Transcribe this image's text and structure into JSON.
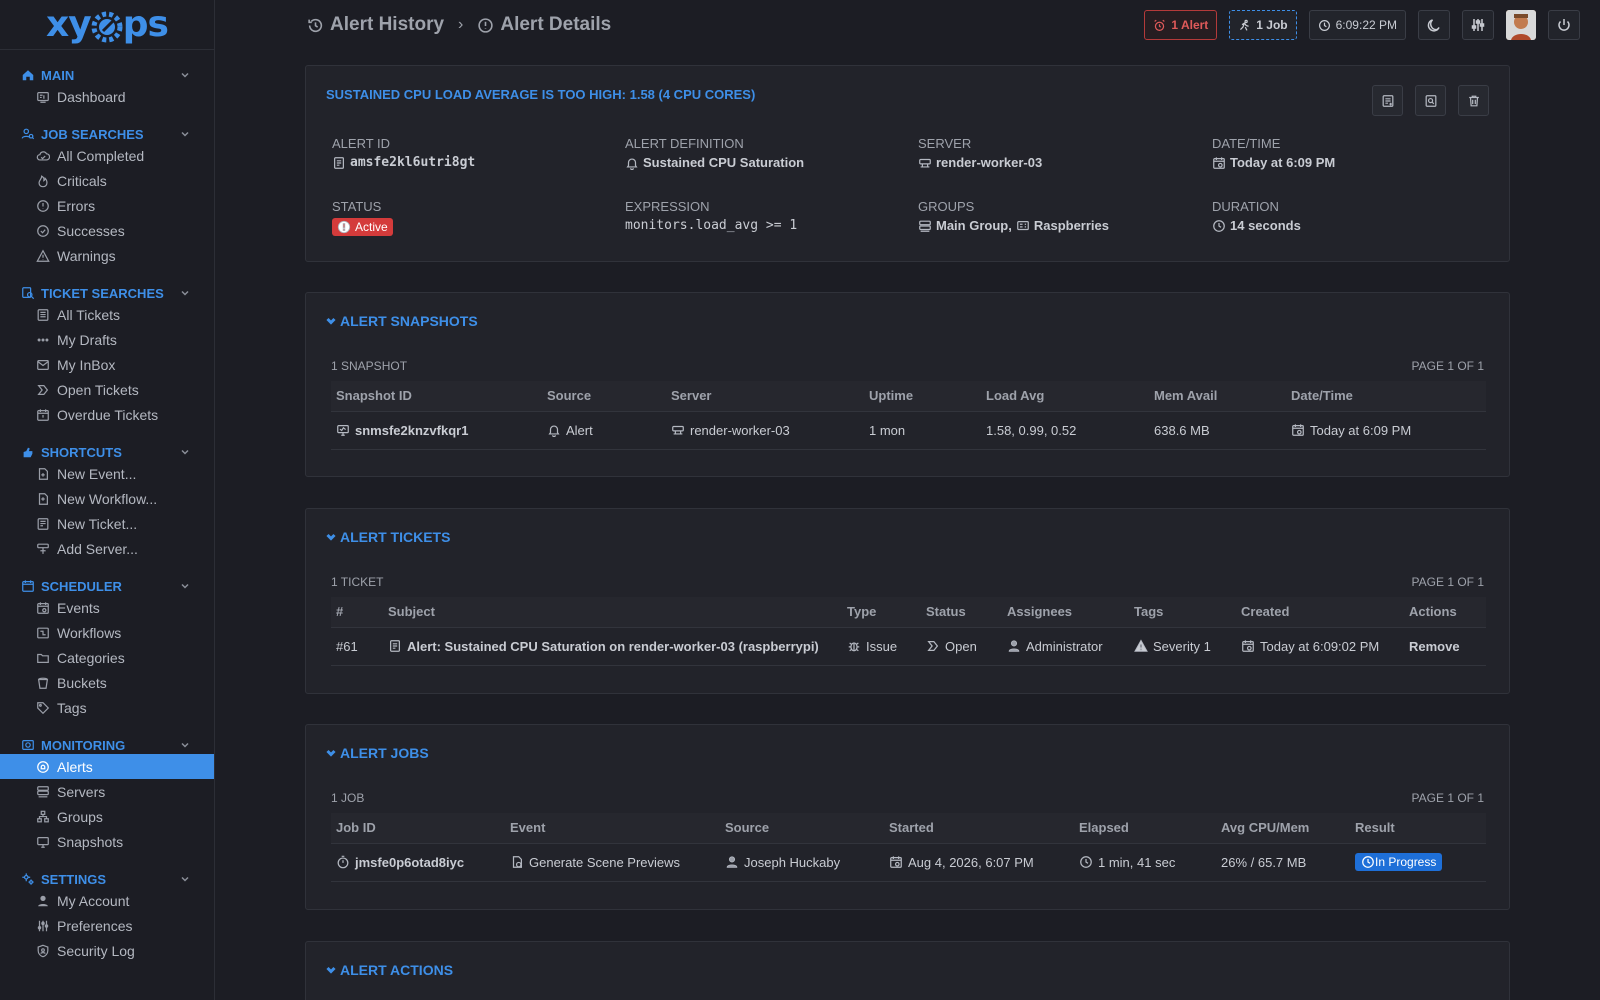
{
  "sidebar": {
    "logo": {
      "left": "xy",
      "right": "ps"
    },
    "sections": [
      {
        "title": "Main",
        "icon": "home-icon",
        "items": [
          {
            "label": "Dashboard",
            "icon": "dashboard-icon"
          }
        ]
      },
      {
        "title": "Job Searches",
        "icon": "job-search-icon",
        "items": [
          {
            "label": "All Completed",
            "icon": "cloud-check-icon"
          },
          {
            "label": "Criticals",
            "icon": "fire-icon"
          },
          {
            "label": "Errors",
            "icon": "alert-circle-icon"
          },
          {
            "label": "Successes",
            "icon": "check-circle-icon"
          },
          {
            "label": "Warnings",
            "icon": "warning-triangle-icon"
          }
        ]
      },
      {
        "title": "Ticket Searches",
        "icon": "ticket-search-icon",
        "items": [
          {
            "label": "All Tickets",
            "icon": "ticket-list-icon"
          },
          {
            "label": "My Drafts",
            "icon": "dots-icon"
          },
          {
            "label": "My InBox",
            "icon": "inbox-icon"
          },
          {
            "label": "Open Tickets",
            "icon": "open-ticket-icon"
          },
          {
            "label": "Overdue Tickets",
            "icon": "calendar-alert-icon"
          }
        ]
      },
      {
        "title": "Shortcuts",
        "icon": "shortcuts-icon",
        "items": [
          {
            "label": "New Event...",
            "icon": "new-event-icon"
          },
          {
            "label": "New Workflow...",
            "icon": "new-workflow-icon"
          },
          {
            "label": "New Ticket...",
            "icon": "new-ticket-icon"
          },
          {
            "label": "Add Server...",
            "icon": "add-server-icon"
          }
        ]
      },
      {
        "title": "Scheduler",
        "icon": "scheduler-icon",
        "items": [
          {
            "label": "Events",
            "icon": "calendar-icon"
          },
          {
            "label": "Workflows",
            "icon": "workflow-icon"
          },
          {
            "label": "Categories",
            "icon": "folder-icon"
          },
          {
            "label": "Buckets",
            "icon": "bucket-icon"
          },
          {
            "label": "Tags",
            "icon": "tag-icon"
          }
        ]
      },
      {
        "title": "Monitoring",
        "icon": "monitoring-icon",
        "items": [
          {
            "label": "Alerts",
            "icon": "alert-bell-icon",
            "active": true
          },
          {
            "label": "Servers",
            "icon": "server-icon"
          },
          {
            "label": "Groups",
            "icon": "groups-icon"
          },
          {
            "label": "Snapshots",
            "icon": "snapshot-icon"
          }
        ]
      },
      {
        "title": "Settings",
        "icon": "settings-icon",
        "items": [
          {
            "label": "My Account",
            "icon": "user-icon"
          },
          {
            "label": "Preferences",
            "icon": "preferences-icon"
          },
          {
            "label": "Security Log",
            "icon": "shield-icon"
          }
        ]
      }
    ]
  },
  "header": {
    "breadcrumb": [
      {
        "label": "Alert History"
      },
      {
        "label": "Alert Details"
      }
    ],
    "alert_count": "1 Alert",
    "job_count": "1 Job",
    "clock": "6:09:22 PM"
  },
  "alert": {
    "title": "Sustained CPU load average is too high: 1.58 (4 CPU cores)",
    "fields": {
      "alert_id": {
        "label": "Alert ID",
        "value": "amsfe2kl6utri8gt"
      },
      "definition": {
        "label": "Alert Definition",
        "value": "Sustained CPU Saturation"
      },
      "server": {
        "label": "Server",
        "value": "render-worker-03"
      },
      "datetime": {
        "label": "Date/Time",
        "value": "Today at 6:09 PM"
      },
      "status": {
        "label": "Status",
        "value": "Active"
      },
      "expression": {
        "label": "Expression",
        "value": "monitors.load_avg >= 1"
      },
      "groups": {
        "label": "Groups",
        "value1": "Main Group,",
        "value2": "Raspberries"
      },
      "duration": {
        "label": "Duration",
        "value": "14 seconds"
      }
    }
  },
  "snapshots": {
    "title": "Alert Snapshots",
    "count": "1 Snapshot",
    "page": "Page 1 of 1",
    "columns": [
      "Snapshot ID",
      "Source",
      "Server",
      "Uptime",
      "Load Avg",
      "Mem Avail",
      "Date/Time"
    ],
    "rows": [
      {
        "id": "snmsfe2knzvfkqr1",
        "source": "Alert",
        "server": "render-worker-03",
        "uptime": "1 mon",
        "load": "1.58, 0.99, 0.52",
        "mem": "638.6 MB",
        "date": "Today at 6:09 PM"
      }
    ]
  },
  "tickets": {
    "title": "Alert Tickets",
    "count": "1 Ticket",
    "page": "Page 1 of 1",
    "columns": [
      "#",
      "Subject",
      "Type",
      "Status",
      "Assignees",
      "Tags",
      "Created",
      "Actions"
    ],
    "rows": [
      {
        "num": "#61",
        "subject": "Alert: Sustained CPU Saturation on render-worker-03 (raspberrypi)",
        "type": "Issue",
        "status": "Open",
        "assignee": "Administrator",
        "tag": "Severity 1",
        "created": "Today at 6:09:02 PM",
        "action": "Remove"
      }
    ]
  },
  "jobs": {
    "title": "Alert Jobs",
    "count": "1 Job",
    "page": "Page 1 of 1",
    "columns": [
      "Job ID",
      "Event",
      "Source",
      "Started",
      "Elapsed",
      "Avg CPU/Mem",
      "Result"
    ],
    "rows": [
      {
        "id": "jmsfe0p6otad8iyc",
        "event": "Generate Scene Previews",
        "source": "Joseph Huckaby",
        "started": "Aug 4, 2026, 6:07 PM",
        "elapsed": "1 min, 41 sec",
        "cpumem": "26% / 65.7 MB",
        "result": "In Progress"
      }
    ]
  },
  "actions": {
    "title": "Alert Actions"
  }
}
